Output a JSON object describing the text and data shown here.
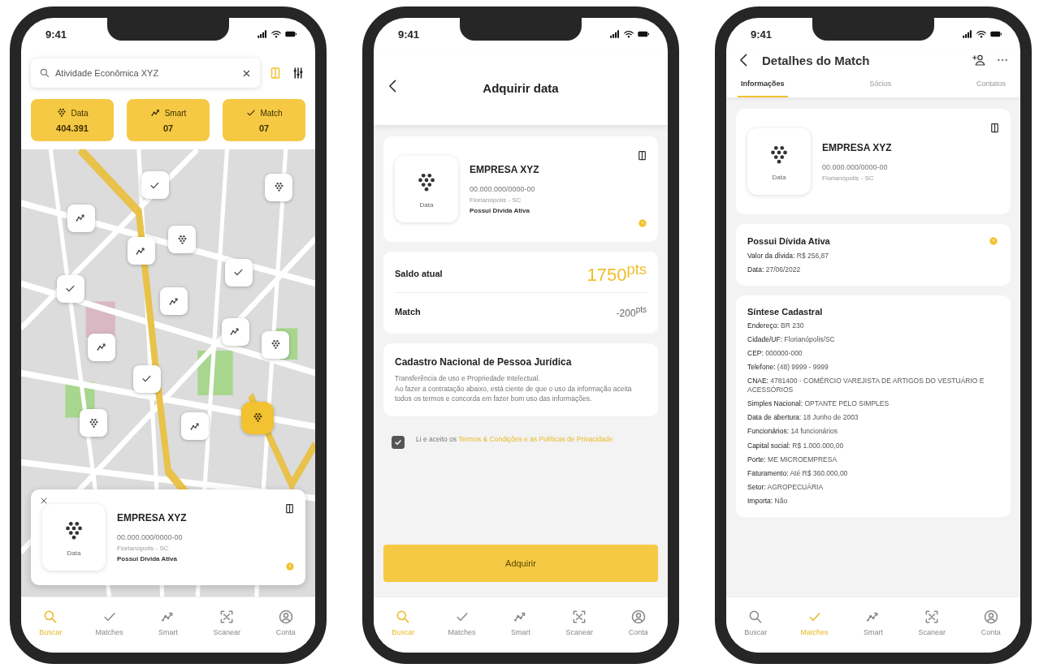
{
  "search_screen": {
    "status_time": "9:41",
    "search": {
      "value": "Atividade Econômica XYZ"
    },
    "stats": [
      {
        "label": "Data",
        "value": "404.391"
      },
      {
        "label": "Smart",
        "value": "07"
      },
      {
        "label": "Match",
        "value": "07"
      }
    ],
    "map_pins": [
      {
        "kind": "match",
        "selected": false
      },
      {
        "kind": "data",
        "selected": false
      },
      {
        "kind": "smart",
        "selected": false
      },
      {
        "kind": "smart",
        "selected": false
      },
      {
        "kind": "data",
        "selected": false
      },
      {
        "kind": "match",
        "selected": false
      },
      {
        "kind": "match",
        "selected": false
      },
      {
        "kind": "smart",
        "selected": false
      },
      {
        "kind": "smart",
        "selected": false
      },
      {
        "kind": "smart",
        "selected": false
      },
      {
        "kind": "data",
        "selected": false
      },
      {
        "kind": "match",
        "selected": false
      },
      {
        "kind": "data",
        "selected": false
      },
      {
        "kind": "smart",
        "selected": false
      },
      {
        "kind": "data",
        "selected": true
      }
    ],
    "company_card": {
      "logo_label": "Data",
      "name": "EMPRESA XYZ",
      "cnpj": "00.000.000/0000-00",
      "location": "Florianópolis - SC",
      "status": "Possui Dívida Ativa"
    },
    "tab_bar": [
      {
        "label": "Buscar",
        "selected": true
      },
      {
        "label": "Matches",
        "selected": false
      },
      {
        "label": "Smart",
        "selected": false
      },
      {
        "label": "Scanear",
        "selected": false
      },
      {
        "label": "Conta",
        "selected": false
      }
    ]
  },
  "purchase_screen": {
    "status_time": "9:41",
    "title": "Adquirir data",
    "company_card": {
      "logo_label": "Data",
      "name": "EMPRESA XYZ",
      "cnpj": "00.000.000/0000-00",
      "location": "Florianópolis - SC",
      "status": "Possui Dívida Ativa"
    },
    "balance": [
      {
        "label": "Saldo atual",
        "value": "1750$^{pts}$",
        "kind": "total"
      },
      {
        "label": "Match",
        "value": "-200$^{pts}$",
        "kind": "cost"
      }
    ],
    "info": {
      "title": "Cadastro Nacional de Pessoa Jurídica",
      "lines": [
        "Transferência de uso e Propriedade Intelectual.",
        "Ao fazer a contratação abaixo, está ciente de que o uso da informação aceita todos os termos e concorda em fazer bom uso das informações."
      ]
    },
    "terms": {
      "checked": true,
      "text": "Li e aceito os",
      "link": "Termos & Condições e as Políticas de Privacidade."
    },
    "button": "Adquirir",
    "tab_bar": [
      {
        "label": "Buscar",
        "selected": true
      },
      {
        "label": "Matches",
        "selected": false
      },
      {
        "label": "Smart",
        "selected": false
      },
      {
        "label": "Scanear",
        "selected": false
      },
      {
        "label": "Conta",
        "selected": false
      }
    ]
  },
  "details_screen": {
    "status_time": "9:41",
    "title": "Detalhes do Match",
    "tabs": [
      {
        "label": "Informações",
        "selected": true
      },
      {
        "label": "Sócios",
        "selected": false
      },
      {
        "label": "Contatos",
        "selected": false
      }
    ],
    "company_card": {
      "logo_label": "Data",
      "name": "EMPRESA XYZ",
      "cnpj": "00.000.000/0000-00",
      "location": "Florianópolis - SC"
    },
    "debt": {
      "title": "Possui Dívida Ativa",
      "lines": [
        {
          "label": "Valor da dívida:",
          "value": "R$ 256,87"
        },
        {
          "label": "Data:",
          "value": "27/06/2022"
        }
      ]
    },
    "summary": {
      "title": "Síntese Cadastral",
      "lines": [
        {
          "label": "Endereço:",
          "value": "BR 230"
        },
        {
          "label": "Cidade/UF:",
          "value": "Florianópolis/SC"
        },
        {
          "label": "CEP:",
          "value": "000000-000"
        },
        {
          "label": "Telefone:",
          "value": "(48) 9999 - 9999"
        },
        {
          "label": "CNAE:",
          "value": "4781400 - COMÉRCIO VAREJISTA DE ARTIGOS DO VESTUÁRIO E ACESSÓRIOS"
        },
        {
          "label": "Simples Nacional:",
          "value": "OPTANTE PELO SIMPLES"
        },
        {
          "label": "Data de abertura:",
          "value": "18 Junho de 2003"
        },
        {
          "label": "Funcionários:",
          "value": "14 funcionários"
        },
        {
          "label": "Capital social:",
          "value": "R$ 1.000.000,00"
        },
        {
          "label": "Porte:",
          "value": "ME MICROEMPRESA"
        },
        {
          "label": "Faturamento:",
          "value": "Até R$ 360.000,00"
        },
        {
          "label": "Setor:",
          "value": "AGROPECUÁRIA"
        },
        {
          "label": "Importa:",
          "value": "Não"
        }
      ]
    },
    "tab_bar": [
      {
        "label": "Buscar",
        "selected": false
      },
      {
        "label": "Matches",
        "selected": true
      },
      {
        "label": "Smart",
        "selected": false
      },
      {
        "label": "Scanear",
        "selected": false
      },
      {
        "label": "Conta",
        "selected": false
      }
    ]
  }
}
